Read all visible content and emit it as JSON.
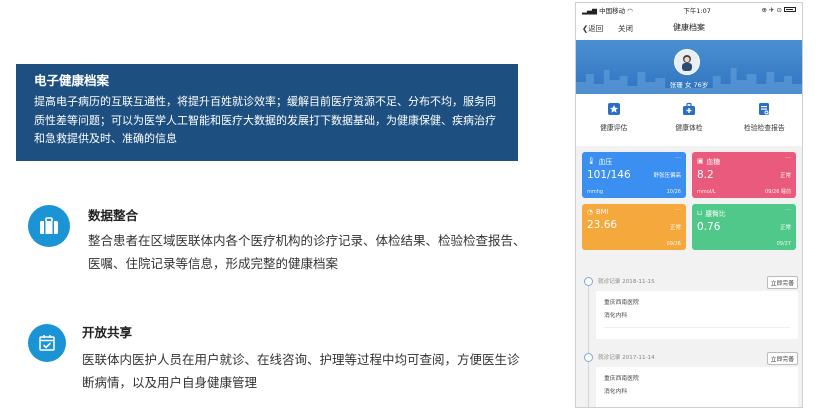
{
  "intro": {
    "title": "电子健康档案",
    "body": "提高电子病历的互联互通性，将提升百姓就诊效率；缓解目前医疗资源不足、分布不均，服务同质性差等问题；可以为医学人工智能和医疗大数据的发展打下数据基础，为健康保健、疾病治疗和急救提供及时、准确的信息"
  },
  "features": [
    {
      "icon": "briefcase-icon",
      "title": "数据整合",
      "desc": "整合患者在区域医联体内各个医疗机构的诊疗记录、体检结果、检验检查报告、医嘱、住院记录等信息，形成完整的健康档案"
    },
    {
      "icon": "calendar-check-icon",
      "title": "开放共享",
      "desc": "医联体内医护人员在用户就诊、在线咨询、护理等过程中均可查阅，方便医生诊断病情，以及用户自身健康管理"
    }
  ],
  "phone": {
    "status": {
      "carrier": "中国移动",
      "time": "下午1:07",
      "icons": "⊕ ✈ ⊙"
    },
    "nav": {
      "back": "❮返回",
      "close": "关闭",
      "title": "健康档案"
    },
    "user": {
      "name": "张珊",
      "gender": "女",
      "age": "76岁"
    },
    "quick": [
      {
        "label": "健康评估",
        "icon": "star-badge-icon",
        "color": "#2b6fc4"
      },
      {
        "label": "健康体检",
        "icon": "medical-kit-icon",
        "color": "#2b6fc4"
      },
      {
        "label": "检验检查报告",
        "icon": "report-icon",
        "color": "#2b6fc4"
      }
    ],
    "cards": [
      {
        "title": "血压",
        "value": "101/146",
        "tag": "舒张压偏高",
        "unit": "mmhg",
        "date": "10/26",
        "color": "#3b8ff0"
      },
      {
        "title": "血糖",
        "value": "8.2",
        "tag": "正常",
        "unit": "mmol/L",
        "date": "09/26 睡前",
        "color": "#e95a7c"
      },
      {
        "title": "BMI",
        "value": "23.66",
        "tag": "正常",
        "unit": "",
        "date": "09/26",
        "color": "#f5a83c"
      },
      {
        "title": "腰臀比",
        "value": "0.76",
        "tag": "正常",
        "unit": "",
        "date": "09/27",
        "color": "#4fc88a"
      }
    ],
    "records": [
      {
        "date": "就诊记录 2018-11-15",
        "button": "立即完善",
        "hospital": "重庆西南医院",
        "dept": "消化内科"
      },
      {
        "date": "就诊记录 2017-11-14",
        "button": "立即完善",
        "hospital": "重庆西南医院",
        "dept": "消化内科"
      }
    ]
  }
}
